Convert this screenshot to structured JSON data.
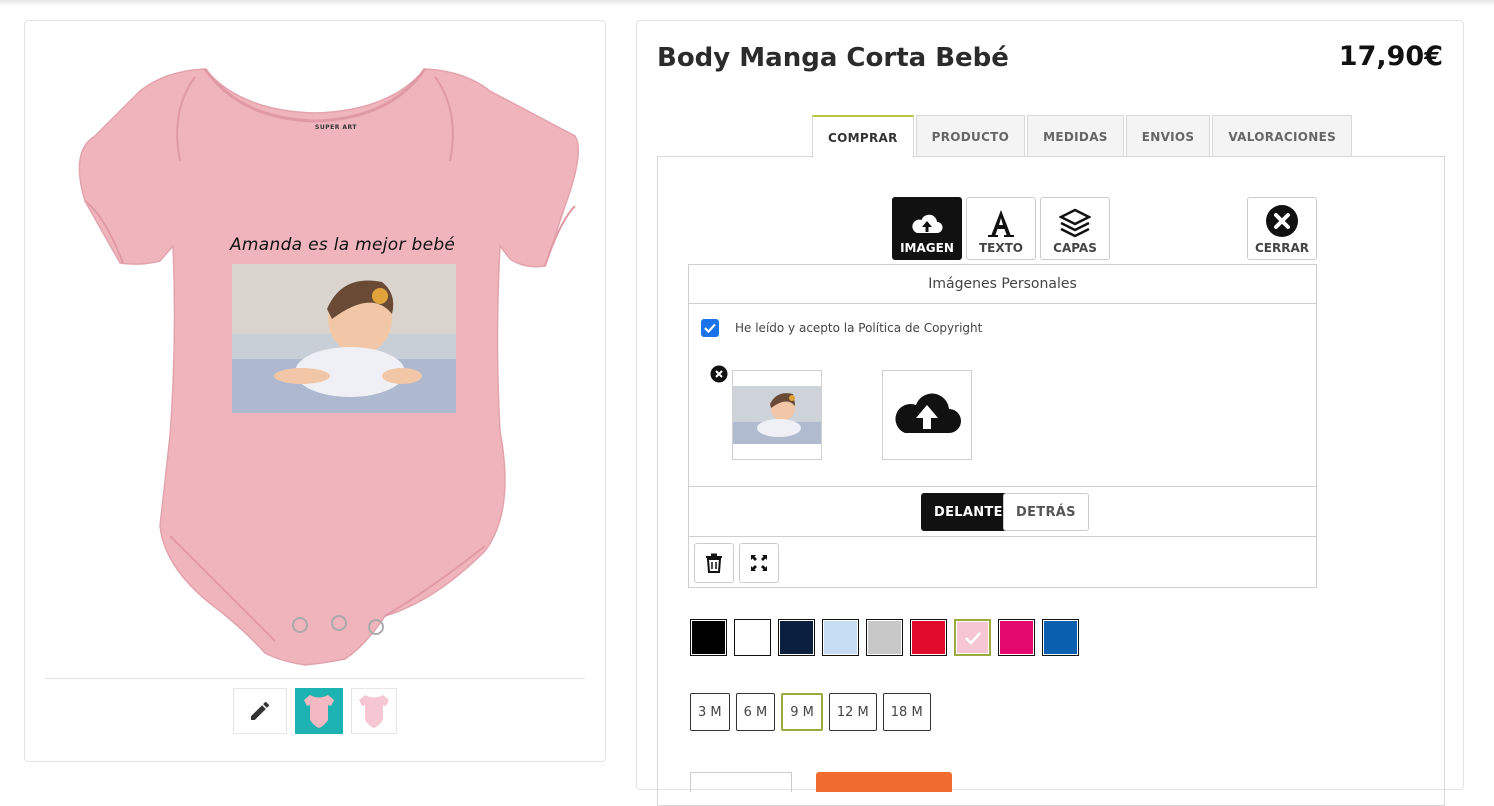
{
  "product": {
    "title": "Body Manga Corta Bebé",
    "price": "17,90€",
    "print_text": "Amanda es la mejor bebé",
    "brand": "SUPER ART",
    "garment_color": "#f0b4bd"
  },
  "tabs": [
    {
      "label": "COMPRAR",
      "active": true
    },
    {
      "label": "PRODUCTO",
      "active": false
    },
    {
      "label": "MEDIDAS",
      "active": false
    },
    {
      "label": "ENVIOS",
      "active": false
    },
    {
      "label": "VALORACIONES",
      "active": false
    }
  ],
  "toolbar": {
    "image_label": "IMAGEN",
    "text_label": "TEXTO",
    "layers_label": "CAPAS",
    "close_label": "CERRAR"
  },
  "editor": {
    "header": "Imágenes Personales",
    "copyright_text": "He leído y acepto la Política de Copyright",
    "copyright_checked": true,
    "front_label": "DELANTE",
    "back_label": "DETRÁS"
  },
  "colors": [
    {
      "name": "black",
      "hex": "#000000",
      "selected": false
    },
    {
      "name": "white",
      "hex": "#ffffff",
      "selected": false
    },
    {
      "name": "navy",
      "hex": "#0b1f3f",
      "selected": false
    },
    {
      "name": "light-blue",
      "hex": "#c5dcf2",
      "selected": false
    },
    {
      "name": "grey",
      "hex": "#c8c8c8",
      "selected": false
    },
    {
      "name": "red",
      "hex": "#e10a2a",
      "selected": false
    },
    {
      "name": "pink",
      "hex": "#f6c7d2",
      "selected": true
    },
    {
      "name": "fuchsia",
      "hex": "#e3096e",
      "selected": false
    },
    {
      "name": "royal-blue",
      "hex": "#0a5fae",
      "selected": false
    }
  ],
  "sizes": [
    {
      "label": "3 M",
      "selected": false
    },
    {
      "label": "6 M",
      "selected": false
    },
    {
      "label": "9 M",
      "selected": true
    },
    {
      "label": "12 M",
      "selected": false
    },
    {
      "label": "18 M",
      "selected": false
    }
  ],
  "accent": "#b6c93a",
  "thumbnails": [
    "edit-thumb",
    "teal-body-thumb",
    "pink-body-thumb"
  ]
}
